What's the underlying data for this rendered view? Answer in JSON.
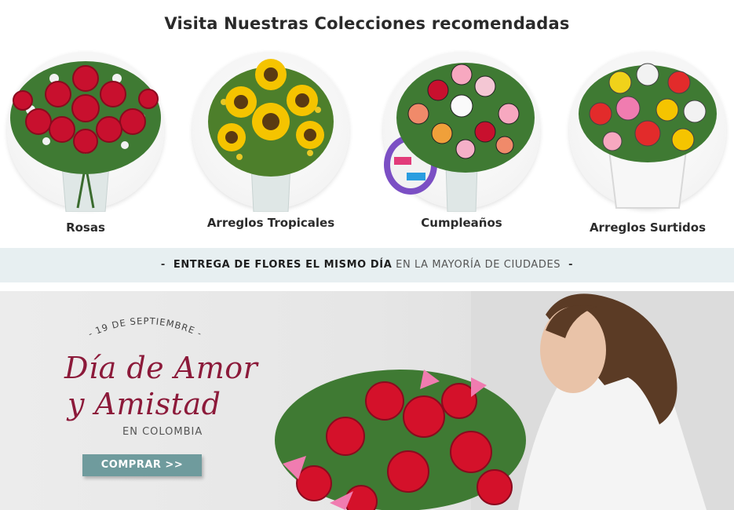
{
  "section_title": "Visita Nuestras Colecciones recomendadas",
  "collections": [
    {
      "label": "Rosas",
      "icon": "rose-bouquet-image"
    },
    {
      "label": "Arreglos Tropicales",
      "icon": "sunflower-bouquet-image"
    },
    {
      "label": "Cumpleaños",
      "icon": "birthday-bouquet-image"
    },
    {
      "label": "Arreglos Surtidos",
      "icon": "mixed-bouquet-image"
    }
  ],
  "delivery_strip": {
    "dash": "-",
    "bold": "ENTREGA DE FLORES EL MISMO DÍA",
    "light": "EN LA MAYORÍA DE CIUDADES"
  },
  "hero": {
    "date": "- 19 DE SEPTIEMBRE -",
    "line1": "Día de Amor",
    "line2": "y Amistad",
    "country": "EN COLOMBIA",
    "button": "COMPRAR >>",
    "colors": {
      "accent": "#8c1a3a",
      "button": "#6f9b9d",
      "strip": "#e7eff1"
    }
  }
}
